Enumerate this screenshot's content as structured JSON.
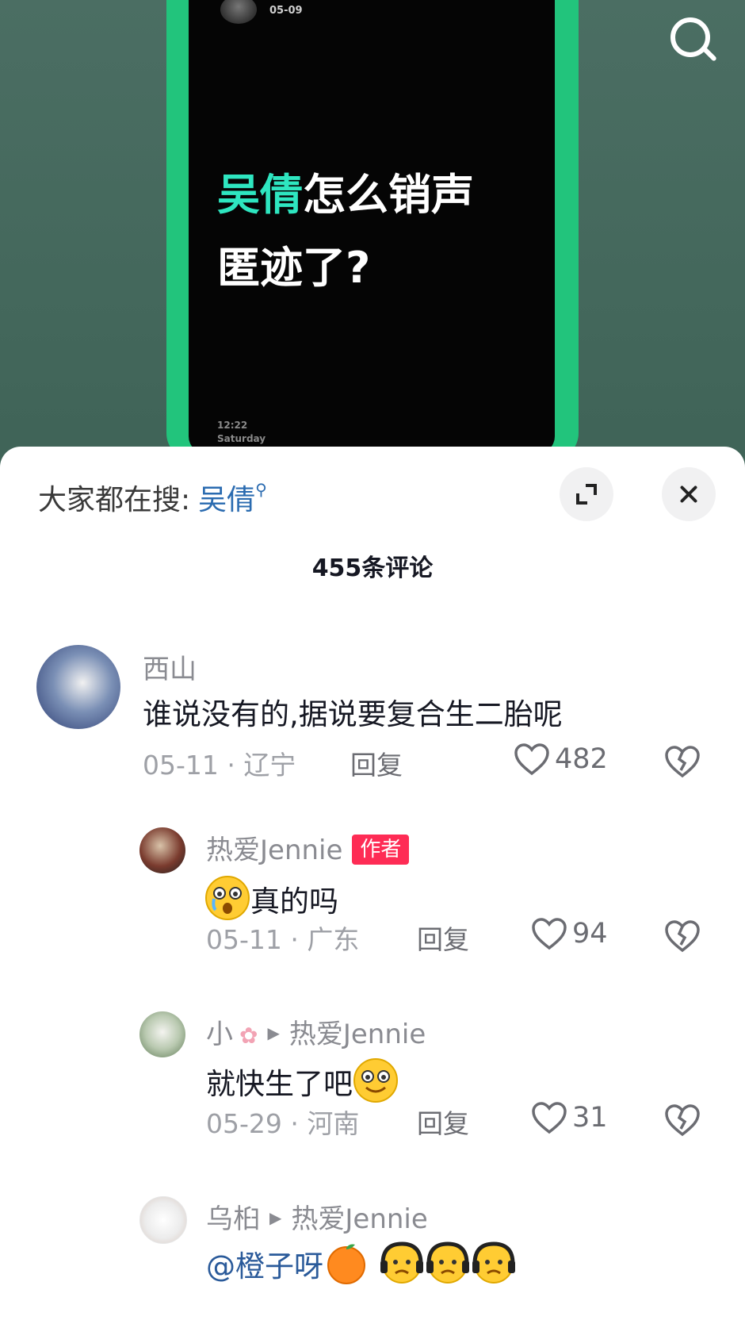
{
  "video": {
    "date": "05-09",
    "title_highlight": "吴倩",
    "title_line1_rest": "怎么销声",
    "title_line2": "匿迹了?",
    "time": "12:22",
    "weekday": "Saturday"
  },
  "sheet": {
    "hot_search_label": "大家都在搜:",
    "hot_search_term": "吴倩",
    "comment_count": "455条评论"
  },
  "comments": [
    {
      "user": "西山",
      "text": "谁说没有的,据说要复合生二胎呢",
      "date": "05-11",
      "location": "辽宁",
      "reply_label": "回复",
      "likes": "482"
    },
    {
      "user": "热爱Jennie",
      "badge": "作者",
      "text": "真的吗",
      "date": "05-11",
      "location": "广东",
      "reply_label": "回复",
      "likes": "94"
    },
    {
      "user": "小",
      "reply_to": "热爱Jennie",
      "text": "就快生了吧",
      "date": "05-29",
      "location": "河南",
      "reply_label": "回复",
      "likes": "31"
    },
    {
      "user": "乌桕",
      "reply_to": "热爱Jennie",
      "text": "@橙子呀"
    }
  ],
  "colors": {
    "phone_frame": "#22c47c",
    "highlight": "#2ee6c0",
    "hot_search_term": "#2a6bb0",
    "author_badge": "#fe2c55"
  },
  "icons": [
    "search-icon",
    "expand-icon",
    "close-icon",
    "heart-icon",
    "broken-heart-icon",
    "emoji-icon"
  ]
}
